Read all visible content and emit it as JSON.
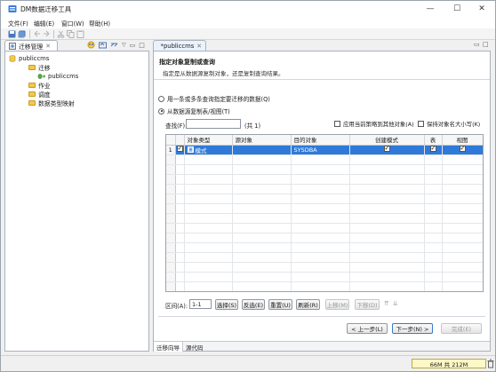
{
  "window": {
    "title": "DM数据迁移工具",
    "controls": {
      "minimize": "—",
      "maximize": "☐",
      "close": "✕"
    }
  },
  "menu": [
    {
      "label": "文件(F)"
    },
    {
      "label": "编辑(E)"
    },
    {
      "label": "窗口(W)"
    },
    {
      "label": "帮助(H)"
    }
  ],
  "left_panel": {
    "tab_label": "迁移管理",
    "tree": {
      "root": "publiccms",
      "migrate": "迁移",
      "migrate_child": "publiccms",
      "job": "作业",
      "schedule": "调度",
      "type_map": "数据类型映射"
    }
  },
  "editor": {
    "tab_label": "*publiccms",
    "section_title": "指定对象复制或查询",
    "section_subtitle": "指定是从数据源复制对象，还是复制查询结果。",
    "option_query": "用一条或多条查询指定要迁移的数据(Q)",
    "option_copy": "从数据源复制表/视图(T)",
    "search_label": "查找(F):",
    "search_value": "",
    "count_text": "(共 1)",
    "apply_rule_label": "应用当前策略到其他对象(A)",
    "keep_case_label": "保持对象名大小写(K)",
    "table": {
      "headers": [
        "对象类型",
        "源对象",
        "目的对象",
        "创建模式",
        "表",
        "视图"
      ],
      "rows": [
        {
          "num": "1",
          "type": "模式",
          "source": "",
          "target": "SYSDBA",
          "create": true,
          "table": true,
          "view": true
        }
      ]
    },
    "range_label": "区间(A):",
    "range_value": "1-1",
    "buttons": {
      "select": "选择(S)",
      "invert": "反选(E)",
      "reset": "重置(U)",
      "refresh": "刷新(R)",
      "move_up": "上移(M)",
      "move_down": "下移(D)"
    },
    "wizard": {
      "back": "< 上一步(L)",
      "next": "下一步(N) >",
      "finish": "完成(E)"
    },
    "bottom_tabs": [
      "迁移向导",
      "源代码"
    ]
  },
  "status": {
    "heap": "66M 共 212M"
  },
  "colors": {
    "selection": "#2f7ad8",
    "panel_border": "#a9b2bd"
  }
}
